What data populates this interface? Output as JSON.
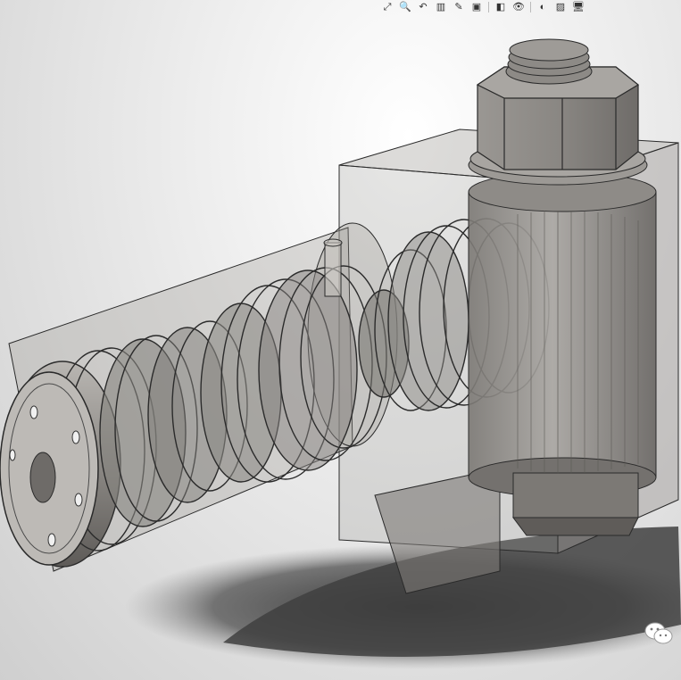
{
  "viewport": {
    "name": "graphics-area",
    "background_top": "#ffffff",
    "background_bottom": "#cfcfcf"
  },
  "toolbar": {
    "items": [
      {
        "name": "zoom-to-fit-icon",
        "glyph": "⤢"
      },
      {
        "name": "zoom-to-area-icon",
        "glyph": "🔍"
      },
      {
        "name": "previous-view-icon",
        "glyph": "↶"
      },
      {
        "name": "section-view-icon",
        "glyph": "▥"
      },
      {
        "name": "dynamic-annotation-icon",
        "glyph": "✎"
      },
      {
        "name": "view-orientation-icon",
        "glyph": "▣"
      },
      {
        "name": "display-style-icon",
        "glyph": "◧"
      },
      {
        "name": "hide-show-items-icon",
        "glyph": "👁"
      },
      {
        "name": "edit-appearance-icon",
        "glyph": "◐"
      },
      {
        "name": "apply-scene-icon",
        "glyph": "▨"
      },
      {
        "name": "view-settings-icon",
        "glyph": "🖥"
      }
    ]
  },
  "model": {
    "body_color": "#8a8783",
    "edge_color": "#2a2a2a",
    "shadow_color": "#3a3a3a",
    "transparency": "semi-transparent housing"
  },
  "watermark": {
    "name": "wechat-logo-icon"
  }
}
